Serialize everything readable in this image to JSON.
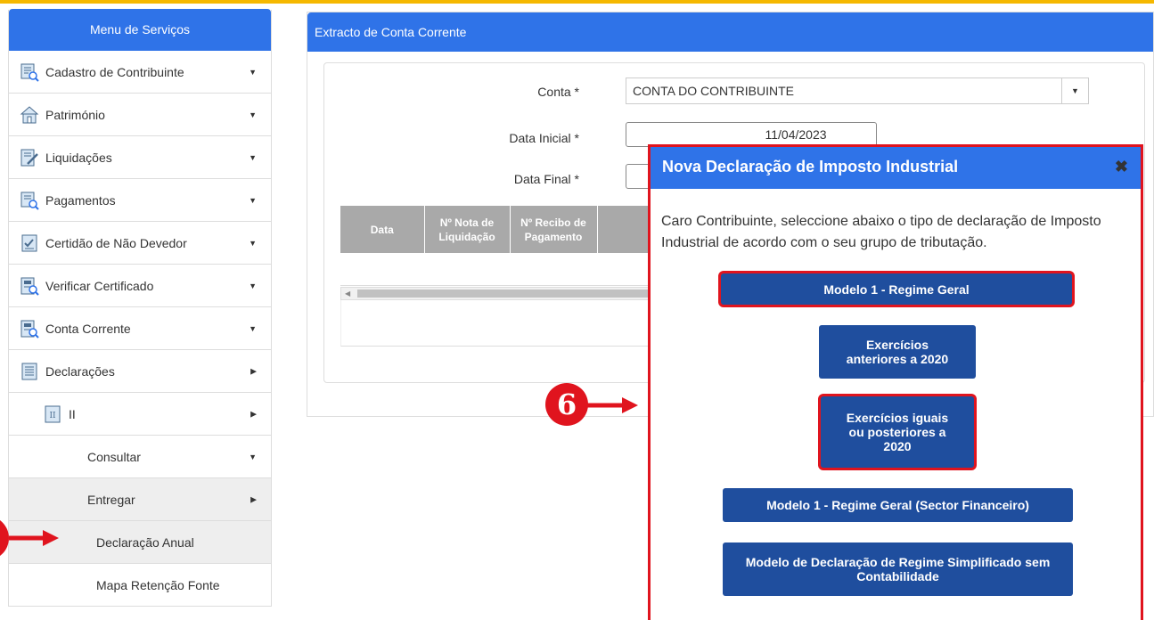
{
  "colors": {
    "accent": "#2f73e8",
    "highlight": "#e0141e",
    "button": "#1f4e9e",
    "top_bar": "#f5b800"
  },
  "sidebar": {
    "title": "Menu de Serviços",
    "items": [
      {
        "label": "Cadastro de Contribuinte",
        "icon": "form-search-icon"
      },
      {
        "label": "Património",
        "icon": "house-icon"
      },
      {
        "label": "Liquidações",
        "icon": "document-edit-icon"
      },
      {
        "label": "Pagamentos",
        "icon": "form-search-icon"
      },
      {
        "label": "Certidão de Não Devedor",
        "icon": "checklist-icon"
      },
      {
        "label": "Verificar Certificado",
        "icon": "certificate-search-icon"
      },
      {
        "label": "Conta Corrente",
        "icon": "certificate-search-icon"
      },
      {
        "label": "Declarações",
        "icon": "document-icon"
      },
      {
        "label": "II",
        "icon": "document-ii-icon"
      },
      {
        "label": "Consultar"
      },
      {
        "label": "Entregar"
      },
      {
        "label": "Declaração Anual"
      },
      {
        "label": "Mapa Retenção Fonte"
      }
    ]
  },
  "panel": {
    "title": "Extracto de Conta Corrente",
    "conta_label": "Conta *",
    "conta_value": "CONTA DO CONTRIBUINTE",
    "data_inicial_label": "Data Inicial *",
    "data_inicial_value": "11/04/2023",
    "data_final_label": "Data Final *",
    "data_final_value": "",
    "table_headers": [
      "Data",
      "Nº Nota de Liquidação",
      "Nº Recibo de Pagamento"
    ]
  },
  "modal": {
    "title": "Nova Declaração de Imposto Industrial",
    "close": "✖",
    "text": "Caro Contribuinte, seleccione abaixo o tipo de declaração de Imposto Industrial de acordo com o seu grupo de tributação.",
    "buttons": {
      "modelo1": "Modelo 1 - Regime Geral",
      "exercicios_anteriores": "Exercícios anteriores a 2020",
      "exercicios_iguais": "Exercícios iguais ou posteriores a 2020",
      "modelo1_financeiro": "Modelo 1 - Regime Geral (Sector Financeiro)",
      "simplificado": "Modelo de Declaração de Regime Simplificado sem Contabilidade"
    }
  },
  "annotations": {
    "step": "6"
  }
}
